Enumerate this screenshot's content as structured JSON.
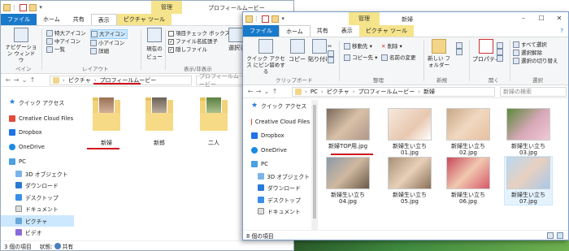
{
  "back_window": {
    "title_context": "管理",
    "title": "プロフィールムービー",
    "tabs": [
      "ファイル",
      "ホーム",
      "共有",
      "表示",
      "ピクチャ ツール"
    ],
    "ribbon": {
      "pane": {
        "nav_pane": "ナビゲーション ウィンドウ",
        "label": "ペイン"
      },
      "layout": {
        "items": [
          "特大アイコン",
          "大アイコン",
          "中アイコン",
          "小アイコン",
          "一覧",
          "詳細"
        ],
        "label": "レイアウト"
      },
      "current_view": "現在のビュー",
      "show_hide": {
        "items": [
          "項目チェック ボックス",
          "ファイル名拡張子",
          "隠しファイル"
        ],
        "selected_items": "選択した項目を",
        "label": "表示/非表示"
      }
    },
    "breadcrumb": [
      "ピクチャ",
      "プロフィールムービー"
    ],
    "search_placeholder": "プロフィールムービー",
    "sidebar": [
      "クイック アクセス",
      "Creative Cloud Files",
      "Dropbox",
      "OneDrive",
      "PC",
      "3D オブジェクト",
      "ダウンロード",
      "デスクトップ",
      "ドキュメント",
      "ピクチャ",
      "ビデオ"
    ],
    "folders": [
      "新婦",
      "新郎",
      "二人"
    ],
    "status": {
      "count": "3 個の項目",
      "state": "状態:",
      "shared": "共有"
    }
  },
  "front_window": {
    "title_context": "管理",
    "title": "新婦",
    "tabs": [
      "ファイル",
      "ホーム",
      "共有",
      "表示",
      "ピクチャ ツール"
    ],
    "ribbon": {
      "clipboard": {
        "pin": "クイック アクセス にピン留めする",
        "copy": "コピー",
        "paste": "貼り付け",
        "label": "クリップボード"
      },
      "organize": {
        "move": "移動先 ▾",
        "copy_to": "コピー先 ▾",
        "delete": "削除 ▾",
        "rename": "名前の変更",
        "label": "整理"
      },
      "new": {
        "folder": "新しい フォルダー",
        "label": "新規"
      },
      "open": {
        "properties": "プロパティ",
        "label": "開く"
      },
      "select": {
        "all": "すべて選択",
        "none": "選択解除",
        "invert": "選択の切り替え",
        "label": "選択"
      }
    },
    "breadcrumb": [
      "PC",
      "ピクチャ",
      "プロフィールムービー",
      "新婦"
    ],
    "search_placeholder": "新婦の検索",
    "sidebar": [
      "クイック アクセス",
      "Creative Cloud Files",
      "Dropbox",
      "OneDrive",
      "PC",
      "3D オブジェクト",
      "ダウンロード",
      "デスクトップ",
      "ドキュメント"
    ],
    "files": [
      "新婦TOP用.jpg",
      "新婦生い立ち 01.jpg",
      "新婦生い立ち 02.jpg",
      "新婦生い立ち 03.jpg",
      "新婦生い立ち 04.jpg",
      "新婦生い立ち 05.jpg",
      "新婦生い立ち 06.jpg",
      "新婦生い立ち 07.jpg"
    ],
    "status": {
      "count": "8 個の項目"
    }
  },
  "colors": {
    "accent": "#1979ca",
    "context": "#f6e48c",
    "underline": "#d0101c",
    "selected": "#cce8ff"
  }
}
